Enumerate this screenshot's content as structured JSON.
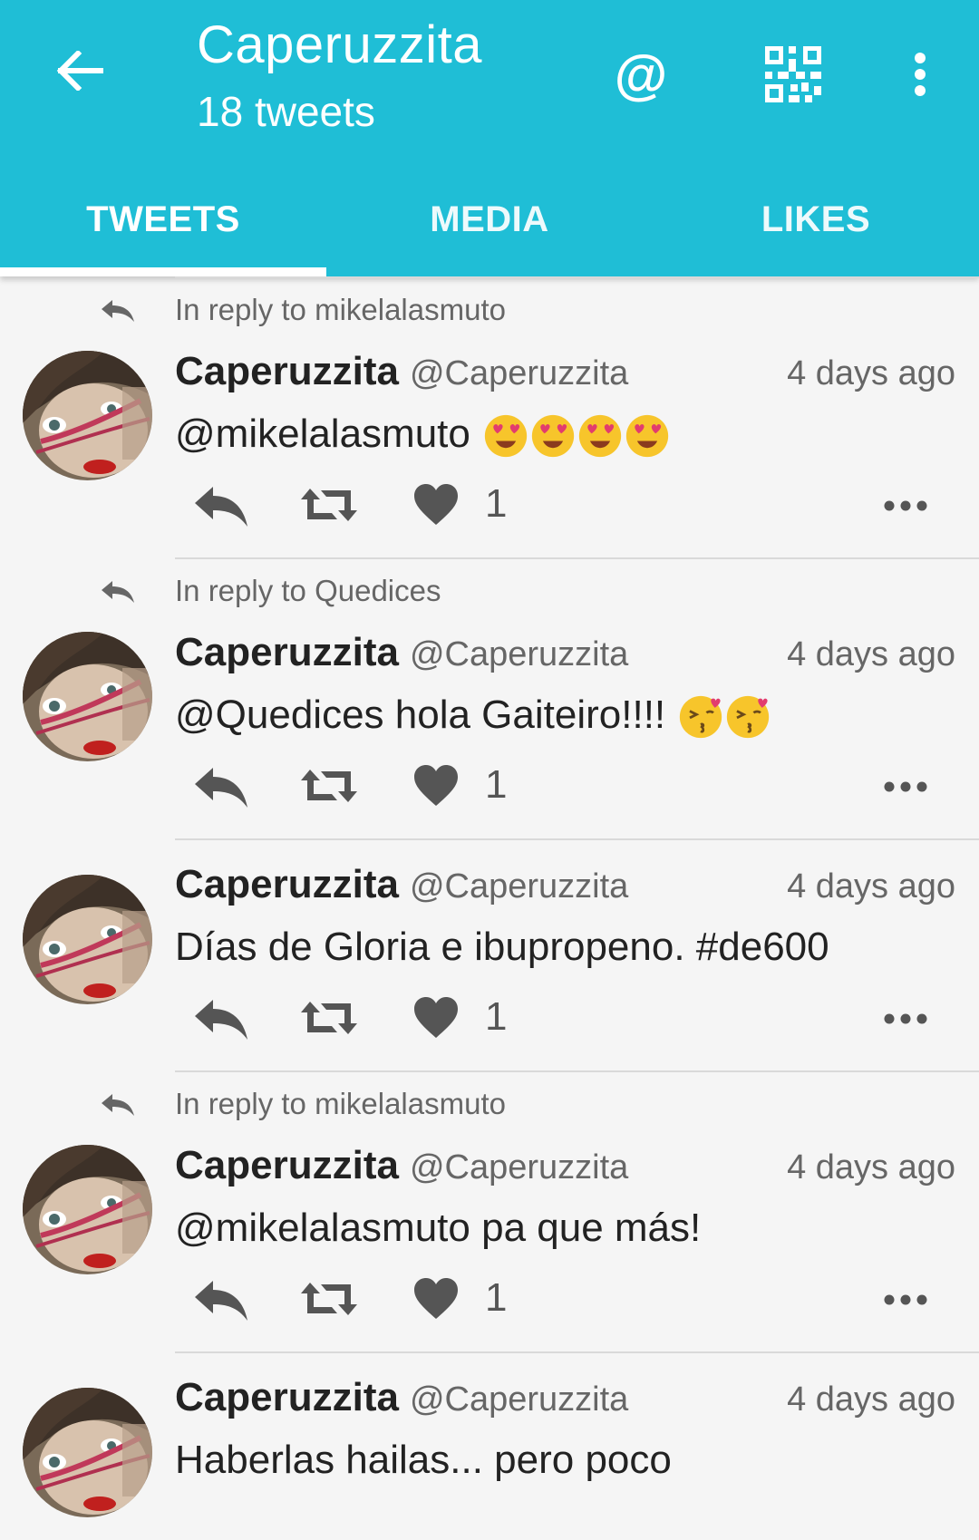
{
  "header": {
    "title": "Caperuzzita",
    "subtitle": "18 tweets",
    "back_icon": "arrow-left-icon",
    "actions": [
      "at-icon",
      "qr-code-icon",
      "more-vert-icon"
    ],
    "at_label": "@",
    "background": "#1fbed6"
  },
  "tabs": [
    {
      "label": "TWEETS",
      "active": true
    },
    {
      "label": "MEDIA",
      "active": false
    },
    {
      "label": "LIKES",
      "active": false
    }
  ],
  "tweets": [
    {
      "reply_to": "In reply to mikelalasmuto",
      "name": "Caperuzzita",
      "handle": "@Caperuzzita",
      "time": "4 days ago",
      "text": "@mikelalasmuto",
      "emoji": [
        "heart-eyes",
        "heart-eyes",
        "heart-eyes",
        "heart-eyes"
      ],
      "likes": "1"
    },
    {
      "reply_to": "In reply to Quedices",
      "name": "Caperuzzita",
      "handle": "@Caperuzzita",
      "time": "4 days ago",
      "text": "@Quedices hola Gaiteiro!!!!",
      "emoji": [
        "kiss-heart",
        "kiss-heart"
      ],
      "likes": "1"
    },
    {
      "reply_to": "",
      "name": "Caperuzzita",
      "handle": "@Caperuzzita",
      "time": "4 days ago",
      "text": "Días de Gloria e ibupropeno. #de600",
      "emoji": [],
      "likes": "1"
    },
    {
      "reply_to": "In reply to mikelalasmuto",
      "name": "Caperuzzita",
      "handle": "@Caperuzzita",
      "time": "4 days ago",
      "text": "@mikelalasmuto pa que más!",
      "emoji": [],
      "likes": "1"
    },
    {
      "reply_to": "",
      "name": "Caperuzzita",
      "handle": "@Caperuzzita",
      "time": "4 days ago",
      "text": "Haberlas hailas... pero poco",
      "emoji": [],
      "likes": ""
    }
  ]
}
